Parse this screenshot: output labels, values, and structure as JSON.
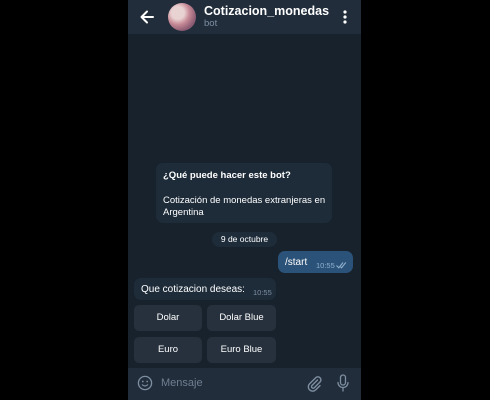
{
  "header": {
    "title": "Cotizacion_monedas",
    "subtitle": "bot"
  },
  "info_bubble": {
    "title": "¿Qué puede hacer este bot?",
    "text": "Cotización de monedas extranjeras en Argentina"
  },
  "date_separator": "9 de octubre",
  "outgoing_message": {
    "text": "/start",
    "time": "10:55"
  },
  "incoming_message": {
    "text": "Que cotizacion deseas:",
    "time": "10:55"
  },
  "keyboard_buttons": [
    "Dolar",
    "Dolar Blue",
    "Euro",
    "Euro Blue"
  ],
  "input": {
    "placeholder": "Mensaje"
  },
  "colors": {
    "background": "#18222d",
    "header": "#212d3b",
    "incoming_bubble": "#1e2c3a",
    "outgoing_bubble": "#2b5278",
    "keyboard_button": "#26313d"
  }
}
